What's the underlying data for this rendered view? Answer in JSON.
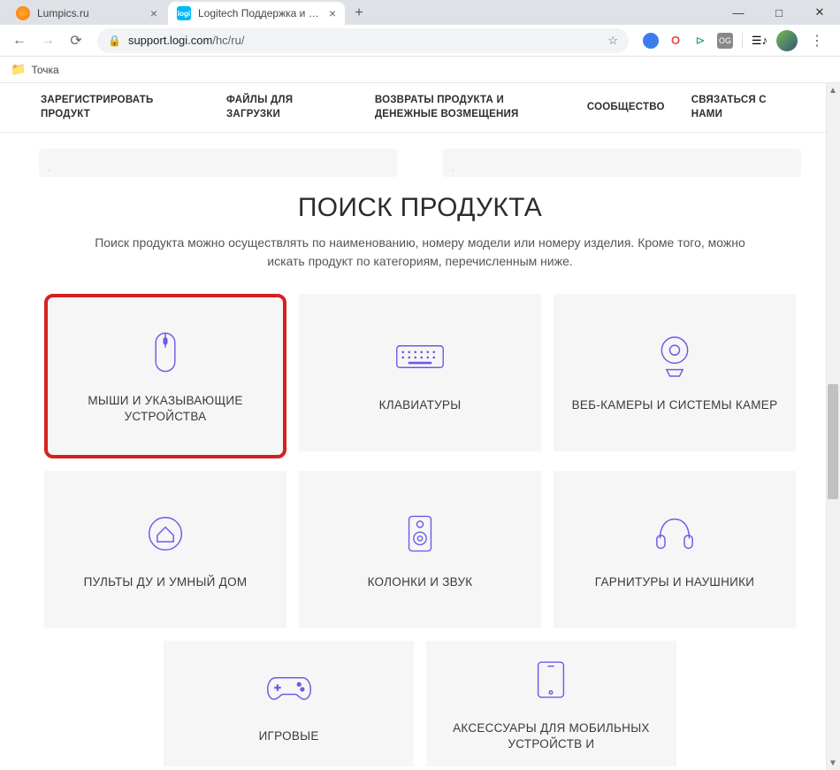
{
  "window": {
    "minimize": "—",
    "maximize": "□",
    "close": "✕"
  },
  "tabs": [
    {
      "title": "Lumpics.ru",
      "active": false
    },
    {
      "title": "Logitech Поддержка и файлы д",
      "active": true
    }
  ],
  "newtab": "+",
  "toolbar": {
    "back": "←",
    "forward": "→",
    "reload": "⟳",
    "url_host": "support.logi.com",
    "url_path": "/hc/ru/",
    "star": "☆"
  },
  "bookmarks": {
    "item1": "Точка"
  },
  "nav": {
    "register": "ЗАРЕГИСТРИРОВАТЬ ПРОДУКТ",
    "downloads": "ФАЙЛЫ ДЛЯ ЗАГРУЗКИ",
    "returns": "ВОЗВРАТЫ ПРОДУКТА И ДЕНЕЖНЫЕ ВОЗМЕЩЕНИЯ",
    "community": "СООБЩЕСТВО",
    "contact": "СВЯЗАТЬСЯ С НАМИ"
  },
  "page": {
    "title": "ПОИСК ПРОДУКТА",
    "desc": "Поиск продукта можно осуществлять по наименованию, номеру модели или номеру изделия. Кроме того, можно искать продукт по категориям, перечисленным ниже."
  },
  "categories": {
    "mice": "МЫШИ И УКАЗЫВАЮЩИЕ УСТРОЙСТВА",
    "keyboards": "КЛАВИАТУРЫ",
    "webcams": "ВЕБ-КАМЕРЫ И СИСТЕМЫ КАМЕР",
    "remotes": "ПУЛЬТЫ ДУ И УМНЫЙ ДОМ",
    "speakers": "КОЛОНКИ И ЗВУК",
    "headsets": "ГАРНИТУРЫ И НАУШНИКИ",
    "gaming": "ИГРОВЫЕ",
    "mobile": "АКСЕССУАРЫ ДЛЯ МОБИЛЬНЫХ УСТРОЙСТВ И"
  }
}
